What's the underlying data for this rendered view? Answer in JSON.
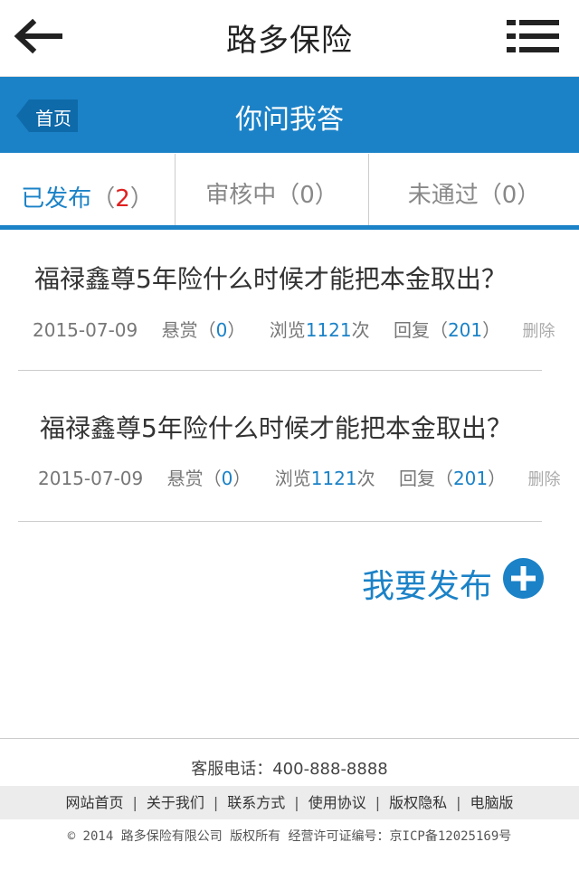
{
  "header": {
    "title": "路多保险",
    "back_icon": "arrow-left-icon",
    "menu_icon": "menu-list-icon"
  },
  "subheader": {
    "home_label": "首页",
    "title": "你问我答",
    "bg_color": "#1b82c7"
  },
  "tabs": [
    {
      "label": "已发布",
      "count": "2",
      "active": true
    },
    {
      "label": "审核中",
      "count": "0",
      "active": false
    },
    {
      "label": "未通过",
      "count": "0",
      "active": false
    }
  ],
  "questions": [
    {
      "title": "福禄鑫尊5年险什么时候才能把本金取出？",
      "date": "2015-07-09",
      "reward_label": "悬赏",
      "reward": "0",
      "views_label": "浏览",
      "views": "1121",
      "views_unit": "次",
      "replies_label": "回复",
      "replies": "201",
      "delete_label": "删除"
    },
    {
      "title": "福禄鑫尊5年险什么时候才能把本金取出？",
      "date": "2015-07-09",
      "reward_label": "悬赏",
      "reward": "0",
      "views_label": "浏览",
      "views": "1121",
      "views_unit": "次",
      "replies_label": "回复",
      "replies": "201",
      "delete_label": "删除"
    }
  ],
  "publish": {
    "label": "我要发布",
    "icon": "plus-circle-icon"
  },
  "footer": {
    "service": "客服电话：400-888-8888",
    "links": [
      "网站首页",
      "关于我们",
      "联系方式",
      "使用协议",
      "版权隐私",
      "电脑版"
    ],
    "separator": "|",
    "copyright": "© 2014 路多保险有限公司 版权所有 经营许可证编号：京ICP备12025169号"
  }
}
